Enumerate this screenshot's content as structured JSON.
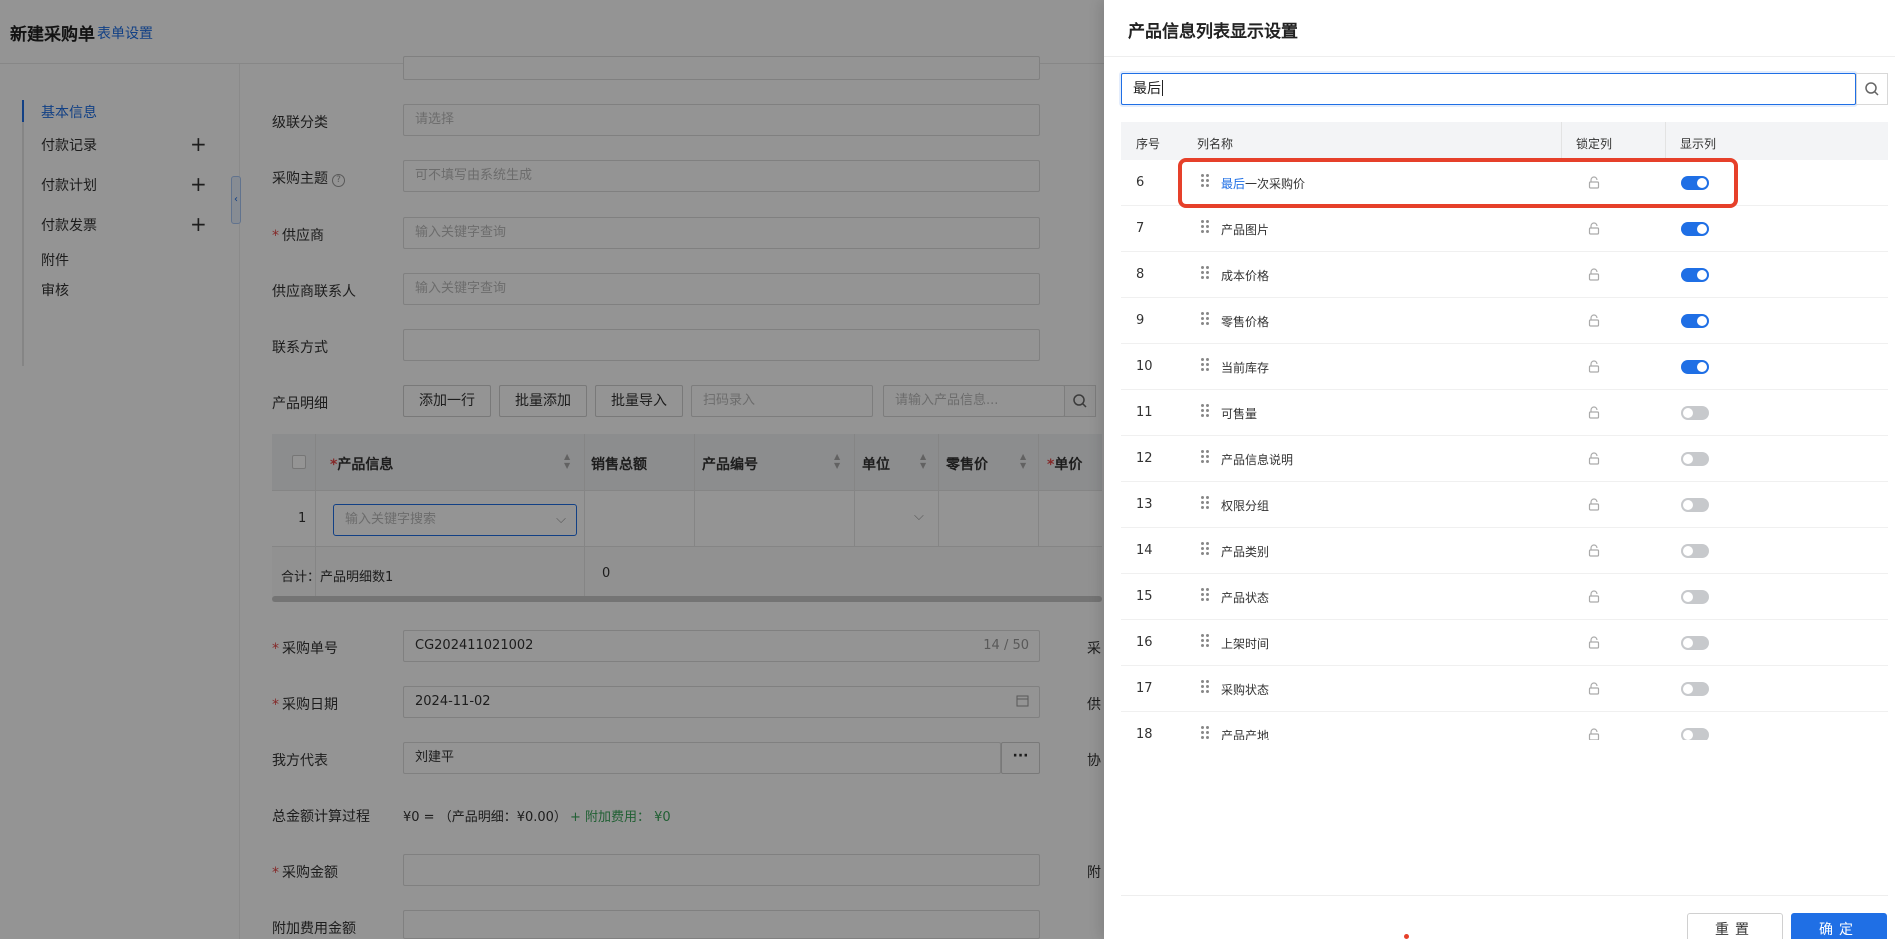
{
  "page": {
    "title": "新建采购单",
    "form_settings_link": "表单设置"
  },
  "sidebar": {
    "items": [
      {
        "label": "基本信息",
        "has_add": false,
        "active": true
      },
      {
        "label": "付款记录",
        "has_add": true
      },
      {
        "label": "付款计划",
        "has_add": true
      },
      {
        "label": "付款发票",
        "has_add": true
      },
      {
        "label": "附件",
        "has_add": false
      },
      {
        "label": "审核",
        "has_add": false
      }
    ],
    "add_symbol": "+",
    "collapse_symbol": "‹"
  },
  "form": {
    "cascade": {
      "label": "级联分类",
      "placeholder": "请选择"
    },
    "subject": {
      "label": "采购主题",
      "help": "?",
      "placeholder": "可不填写由系统生成"
    },
    "supplier": {
      "label": "供应商",
      "required": "*",
      "placeholder": "输入关键字查询"
    },
    "contact": {
      "label": "供应商联系人",
      "placeholder": "输入关键字查询"
    },
    "phone": {
      "label": "联系方式",
      "value": ""
    },
    "products": {
      "label": "产品明细",
      "add_row": "添加一行",
      "bulk_add": "批量添加",
      "bulk_import": "批量导入",
      "scan_placeholder": "扫码录入",
      "search_placeholder": "请输入产品信息..."
    },
    "order_no": {
      "label": "采购单号",
      "required": "*",
      "value": "CG202411021002",
      "counter": "14 / 50"
    },
    "order_date": {
      "label": "采购日期",
      "required": "*",
      "value": "2024-11-02"
    },
    "rep": {
      "label": "我方代表",
      "value": "刘建平",
      "more": "···"
    },
    "total_calc": {
      "label": "总金额计算过程",
      "formula": "¥0 = （产品明细：¥0.00）",
      "extra": "+ 附加费用： ¥0"
    },
    "amount": {
      "label": "采购金额",
      "required": "*",
      "value": ""
    },
    "extra_fee": {
      "label": "附加费用金额",
      "value": ""
    },
    "right_labels": [
      "采",
      "供",
      "协",
      "附"
    ]
  },
  "grid": {
    "headers": [
      {
        "label": "产品信息",
        "required": "*"
      },
      {
        "label": "销售总额"
      },
      {
        "label": "产品编号"
      },
      {
        "label": "单位"
      },
      {
        "label": "零售价"
      },
      {
        "label": "单价",
        "required": "*"
      }
    ],
    "row_index": "1",
    "row_input_placeholder": "输入关键字搜索",
    "footer_label": "合计：产品明细数1",
    "footer_value": "0"
  },
  "drawer": {
    "title": "产品信息列表显示设置",
    "search_value": "最后",
    "columns": {
      "index": "序号",
      "name": "列名称",
      "lock": "锁定列",
      "show": "显示列"
    },
    "rows": [
      {
        "index": "6",
        "name_highlight": "最后",
        "name_rest": "一次采购价",
        "show": true
      },
      {
        "index": "7",
        "name_highlight": "",
        "name_rest": "产品图片",
        "show": true
      },
      {
        "index": "8",
        "name_highlight": "",
        "name_rest": "成本价格",
        "show": true
      },
      {
        "index": "9",
        "name_highlight": "",
        "name_rest": "零售价格",
        "show": true
      },
      {
        "index": "10",
        "name_highlight": "",
        "name_rest": "当前库存",
        "show": true
      },
      {
        "index": "11",
        "name_highlight": "",
        "name_rest": "可售量",
        "show": false
      },
      {
        "index": "12",
        "name_highlight": "",
        "name_rest": "产品信息说明",
        "show": false
      },
      {
        "index": "13",
        "name_highlight": "",
        "name_rest": "权限分组",
        "show": false
      },
      {
        "index": "14",
        "name_highlight": "",
        "name_rest": "产品类别",
        "show": false
      },
      {
        "index": "15",
        "name_highlight": "",
        "name_rest": "产品状态",
        "show": false
      },
      {
        "index": "16",
        "name_highlight": "",
        "name_rest": "上架时间",
        "show": false
      },
      {
        "index": "17",
        "name_highlight": "",
        "name_rest": "采购状态",
        "show": false
      },
      {
        "index": "18",
        "name_highlight": "",
        "name_rest": "产品产地",
        "show": false
      }
    ],
    "reset_label": "重置",
    "ok_label": "确定"
  },
  "colors": {
    "accent": "#1f6fe5",
    "highlight_box": "#e6402a",
    "toggle_off": "#c7c9cc",
    "green_text": "#3aa55a"
  }
}
